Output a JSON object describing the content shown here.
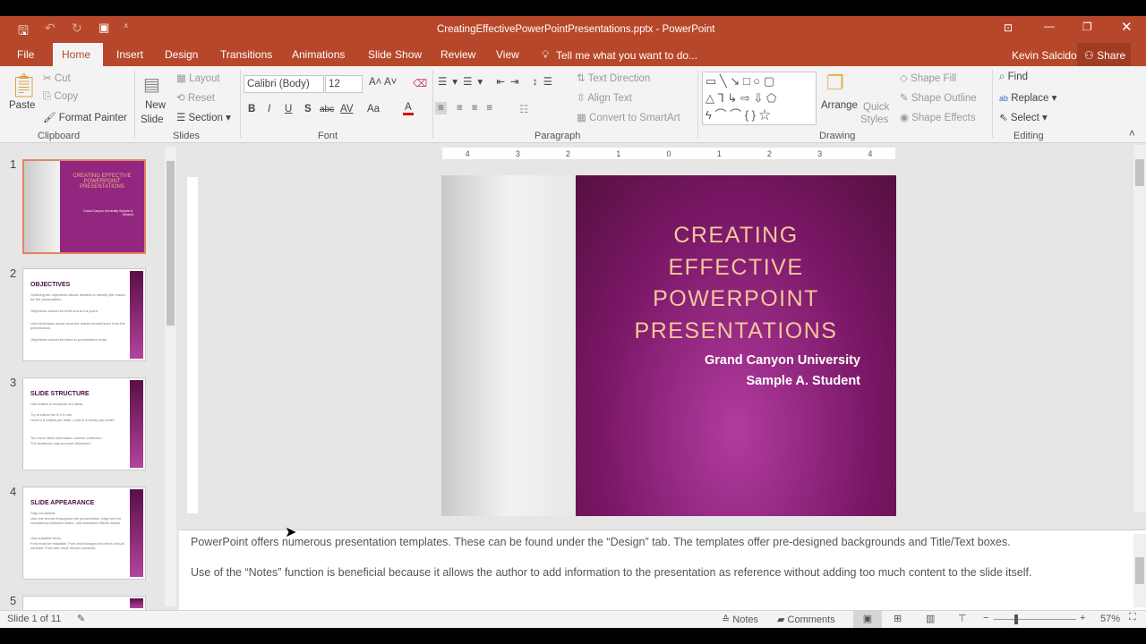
{
  "window": {
    "title": "CreatingEffectivePowerPointPresentations.pptx - PowerPoint",
    "user": "Kevin Salcido",
    "share": "Share"
  },
  "tabs": [
    "File",
    "Home",
    "Insert",
    "Design",
    "Transitions",
    "Animations",
    "Slide Show",
    "Review",
    "View"
  ],
  "tell_me": "Tell me what you want to do...",
  "ribbon": {
    "clipboard": {
      "paste": "Paste",
      "cut": "Cut",
      "copy": "Copy",
      "format_painter": "Format Painter",
      "label": "Clipboard"
    },
    "slides": {
      "new_slide": "New",
      "new_slide2": "Slide",
      "layout": "Layout",
      "reset": "Reset",
      "section": "Section",
      "label": "Slides"
    },
    "font": {
      "name": "Calibri (Body)",
      "size": "12",
      "bold": "B",
      "italic": "I",
      "underline": "U",
      "shadow": "S",
      "strike": "abc",
      "spacing": "AV",
      "case": "Aa",
      "color": "A",
      "label": "Font"
    },
    "paragraph": {
      "text_direction": "Text Direction",
      "align_text": "Align Text",
      "smartart": "Convert to SmartArt",
      "label": "Paragraph"
    },
    "drawing": {
      "arrange": "Arrange",
      "quick_styles": "Quick",
      "quick_styles2": "Styles",
      "shape_fill": "Shape Fill",
      "shape_outline": "Shape Outline",
      "shape_effects": "Shape Effects",
      "label": "Drawing"
    },
    "editing": {
      "find": "Find",
      "replace": "Replace",
      "select": "Select",
      "label": "Editing"
    }
  },
  "thumbnails": [
    {
      "num": "1",
      "title": "CREATING EFFECTIVE POWERPOINT PRESENTATIONS",
      "sub": "Grand Canyon University Sample A. Student"
    },
    {
      "num": "2",
      "title": "OBJECTIVES",
      "lines": [
        "Outlining the objectives allows readers to identify the reason for the presentation.",
        "Objectives should be brief and to the point.",
        "List information about what the reader should learn from the presentation.",
        "Objectives should be listed in presentation order."
      ]
    },
    {
      "num": "3",
      "title": "SLIDE STRUCTURE",
      "lines": [
        "Use bullets to separate out ideas.",
        "Try to follow the 6 X 6 rule.",
        "Limit to 6 bullets per slide. Limit to 6 words per bullet.",
        "Too much slide information causes confusion.",
        "The audience may become distracted."
      ]
    },
    {
      "num": "4",
      "title": "SLIDE APPEARANCE",
      "lines": [
        "Stay consistent.",
        "Use one theme throughout the presentation. Align text for consistency between slides. Use transition effects wisely.",
        "Use readable fonts.",
        "Font must be readable. Font and background colors should contrast. Font size must remain constant."
      ]
    },
    {
      "num": "5"
    }
  ],
  "slide": {
    "title_lines": [
      "CREATING",
      "EFFECTIVE",
      "POWERPOINT",
      "PRESENTATIONS"
    ],
    "subtitle_lines": [
      "Grand Canyon University",
      "Sample A. Student"
    ]
  },
  "ruler": [
    "4",
    "3",
    "2",
    "1",
    "0",
    "1",
    "2",
    "3",
    "4"
  ],
  "notes": [
    "PowerPoint offers numerous presentation templates. These can be found under the “Design” tab. The templates offer pre-designed backgrounds and Title/Text boxes.",
    "Use of the “Notes” function is beneficial because it allows the author to add information to the presentation as reference without adding too much content to the slide itself."
  ],
  "status": {
    "slide": "Slide 1 of 11",
    "notes": "Notes",
    "comments": "Comments",
    "zoom": "57%"
  },
  "colors": {
    "accent": "#b7472a",
    "slide": "#8a1f78",
    "title_text": "#f2c79a"
  }
}
